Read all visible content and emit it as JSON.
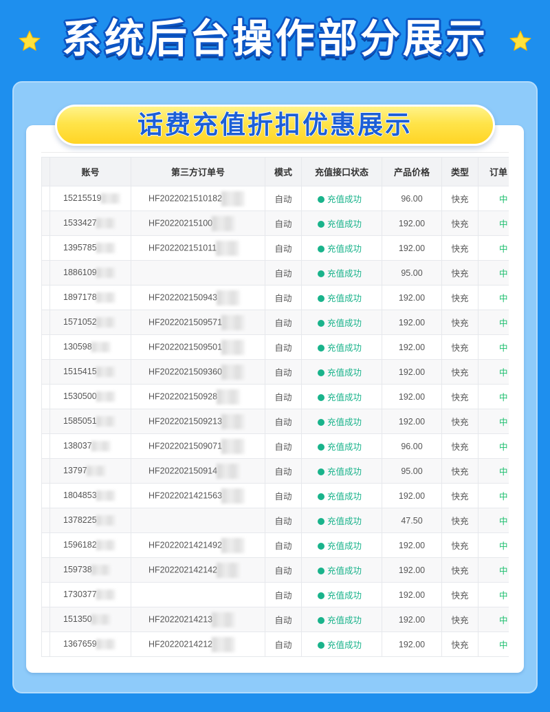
{
  "colors": {
    "background": "#1e8fee",
    "panel": "#8ecbfa",
    "banner_text": "#1d5fd6",
    "success_green": "#19b38b",
    "state_green": "#19be6b"
  },
  "header": {
    "title": "系统后台操作部分展示",
    "left_icon": "star-icon",
    "right_icon": "star-icon"
  },
  "banner": {
    "text": "话费充值折扣优惠展示"
  },
  "table": {
    "columns": [
      "账号",
      "第三方订单号",
      "模式",
      "充值接口状态",
      "产品价格",
      "类型",
      "订单"
    ],
    "rows": [
      {
        "account": "15215519",
        "order": "HF2022021510182",
        "mode": "自动",
        "status": "充值成功",
        "price": "96.00",
        "type": "快充",
        "state": "中"
      },
      {
        "account": "1533427",
        "order": "HF20220215100",
        "mode": "自动",
        "status": "充值成功",
        "price": "192.00",
        "type": "快充",
        "state": "中"
      },
      {
        "account": "1395785",
        "order": "HF202202151011",
        "mode": "自动",
        "status": "充值成功",
        "price": "192.00",
        "type": "快充",
        "state": "中"
      },
      {
        "account": "1886109",
        "order": "",
        "mode": "自动",
        "status": "充值成功",
        "price": "95.00",
        "type": "快充",
        "state": "中"
      },
      {
        "account": "1897178",
        "order": "HF202202150943",
        "mode": "自动",
        "status": "充值成功",
        "price": "192.00",
        "type": "快充",
        "state": "中"
      },
      {
        "account": "1571052",
        "order": "HF2022021509571",
        "mode": "自动",
        "status": "充值成功",
        "price": "192.00",
        "type": "快充",
        "state": "中"
      },
      {
        "account": "130598",
        "order": "HF2022021509501",
        "mode": "自动",
        "status": "充值成功",
        "price": "192.00",
        "type": "快充",
        "state": "中"
      },
      {
        "account": "1515415",
        "order": "HF2022021509360",
        "mode": "自动",
        "status": "充值成功",
        "price": "192.00",
        "type": "快充",
        "state": "中"
      },
      {
        "account": "1530500",
        "order": "HF202202150928",
        "mode": "自动",
        "status": "充值成功",
        "price": "192.00",
        "type": "快充",
        "state": "中"
      },
      {
        "account": "1585051",
        "order": "HF2022021509213",
        "mode": "自动",
        "status": "充值成功",
        "price": "192.00",
        "type": "快充",
        "state": "中"
      },
      {
        "account": "138037",
        "order": "HF2022021509071",
        "mode": "自动",
        "status": "充值成功",
        "price": "96.00",
        "type": "快充",
        "state": "中"
      },
      {
        "account": "13797",
        "order": "HF202202150914",
        "mode": "自动",
        "status": "充值成功",
        "price": "95.00",
        "type": "快充",
        "state": "中"
      },
      {
        "account": "1804853",
        "order": "HF2022021421563",
        "mode": "自动",
        "status": "充值成功",
        "price": "192.00",
        "type": "快充",
        "state": "中"
      },
      {
        "account": "1378225",
        "order": "",
        "mode": "自动",
        "status": "充值成功",
        "price": "47.50",
        "type": "快充",
        "state": "中"
      },
      {
        "account": "1596182",
        "order": "HF2022021421492",
        "mode": "自动",
        "status": "充值成功",
        "price": "192.00",
        "type": "快充",
        "state": "中"
      },
      {
        "account": "159738",
        "order": "HF202202142142",
        "mode": "自动",
        "status": "充值成功",
        "price": "192.00",
        "type": "快充",
        "state": "中"
      },
      {
        "account": "1730377",
        "order": "",
        "mode": "自动",
        "status": "充值成功",
        "price": "192.00",
        "type": "快充",
        "state": "中"
      },
      {
        "account": "151350",
        "order": "HF20220214213",
        "mode": "自动",
        "status": "充值成功",
        "price": "192.00",
        "type": "快充",
        "state": "中"
      },
      {
        "account": "1367659",
        "order": "HF20220214212",
        "mode": "自动",
        "status": "充值成功",
        "price": "192.00",
        "type": "快充",
        "state": "中"
      }
    ]
  }
}
